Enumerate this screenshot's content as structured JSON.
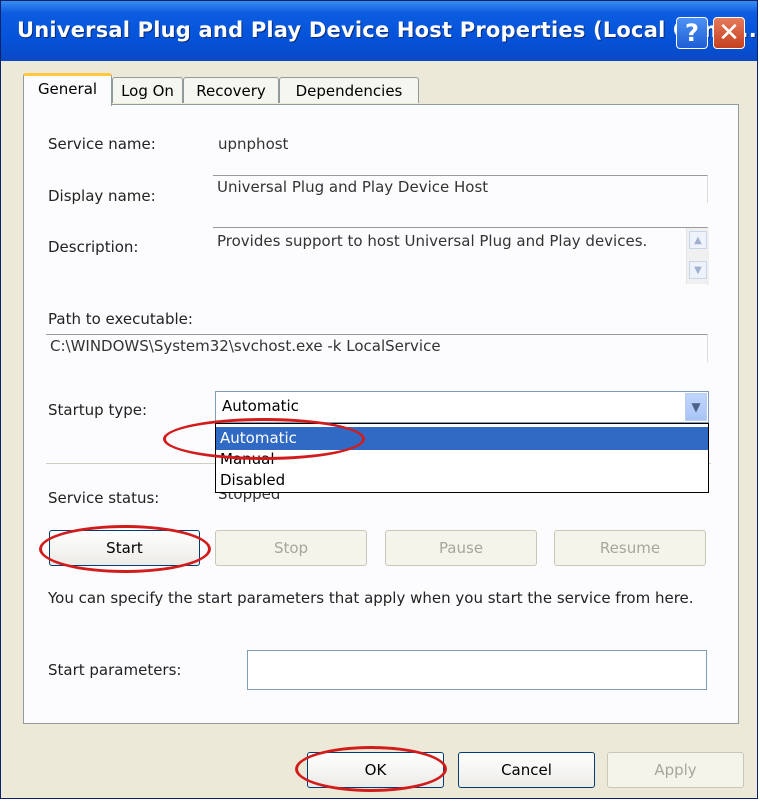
{
  "window": {
    "title": "Universal Plug and Play Device Host Properties (Local Comp...",
    "help_glyph": "?",
    "close_glyph": "✕"
  },
  "tabs": [
    {
      "label": "General",
      "active": true
    },
    {
      "label": "Log On",
      "active": false
    },
    {
      "label": "Recovery",
      "active": false
    },
    {
      "label": "Dependencies",
      "active": false
    }
  ],
  "general": {
    "service_name_label": "Service name:",
    "service_name": "upnphost",
    "display_name_label": "Display name:",
    "display_name": "Universal Plug and Play Device Host",
    "description_label": "Description:",
    "description": "Provides support to host Universal Plug and Play devices.",
    "path_label": "Path to executable:",
    "path": "C:\\WINDOWS\\System32\\svchost.exe -k LocalService",
    "startup_type_label": "Startup type:",
    "startup_type_value": "Automatic",
    "startup_options": [
      "Automatic",
      "Manual",
      "Disabled"
    ],
    "service_status_label": "Service status:",
    "service_status": "Stopped",
    "buttons": {
      "start": "Start",
      "stop": "Stop",
      "pause": "Pause",
      "resume": "Resume"
    },
    "info_text": "You can specify the start parameters that apply when you start the service from here.",
    "start_params_label": "Start parameters:",
    "start_params_value": ""
  },
  "footer": {
    "ok": "OK",
    "cancel": "Cancel",
    "apply": "Apply"
  },
  "colors": {
    "titlebar": "#0553d9",
    "selection": "#316ac5",
    "highlight_ring": "#d21c1c",
    "active_tab_accent": "#ffc83c"
  }
}
